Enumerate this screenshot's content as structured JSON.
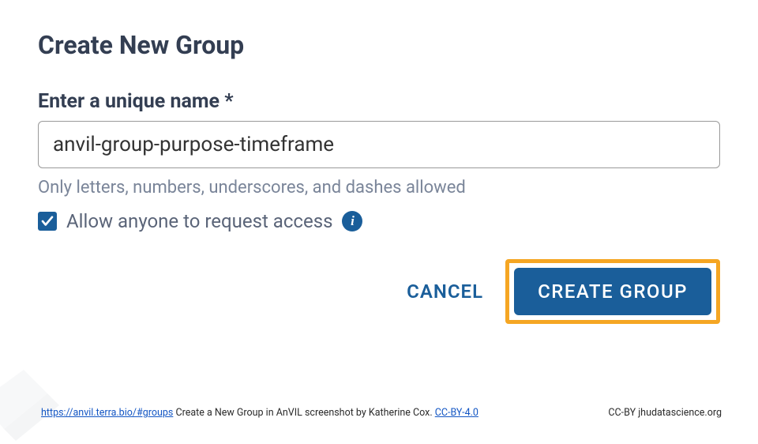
{
  "dialog": {
    "title": "Create New Group",
    "field_label": "Enter a unique name *",
    "input_value": "anvil-group-purpose-timeframe",
    "hint": "Only letters, numbers, underscores, and dashes allowed",
    "checkbox_label": "Allow anyone to request access",
    "checkbox_checked": true,
    "cancel_label": "CANCEL",
    "create_label": "CREATE GROUP"
  },
  "footer": {
    "source_url": "https://anvil.terra.bio/#groups",
    "caption_mid": " Create a New Group in AnVIL screenshot by Katherine Cox. ",
    "license_link": "CC-BY-4.0",
    "right": "CC-BY  jhudatascience.org"
  }
}
